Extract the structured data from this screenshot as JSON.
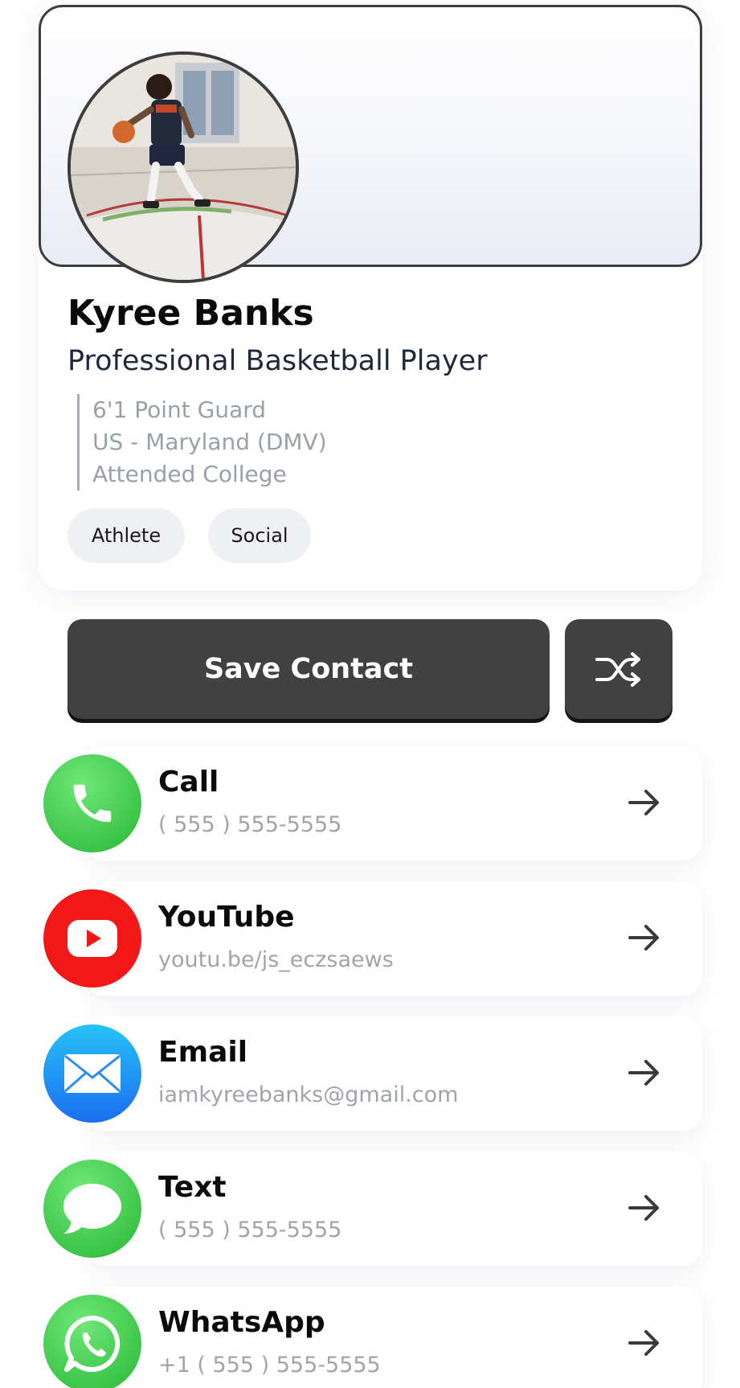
{
  "profile": {
    "name": "Kyree Banks",
    "title": "Professional Basketball Player",
    "bio": [
      "6'1 Point Guard",
      "US - Maryland (DMV)",
      "Attended College"
    ],
    "tags": [
      "Athlete",
      "Social"
    ]
  },
  "actions": {
    "save_label": "Save Contact",
    "shuffle_icon": "shuffle-icon"
  },
  "links": [
    {
      "title": "Call",
      "subtitle": "( 555 ) 555-5555",
      "icon": "phone-icon",
      "color": "#32c83f"
    },
    {
      "title": "YouTube",
      "subtitle": "youtu.be/js_eczsaews",
      "icon": "youtube-icon",
      "color": "#f21818"
    },
    {
      "title": "Email",
      "subtitle": "iamkyreebanks@gmail.com",
      "icon": "mail-icon",
      "color": "#2a8ef5"
    },
    {
      "title": "Text",
      "subtitle": "( 555 ) 555-5555",
      "icon": "message-icon",
      "color": "#32c83f"
    },
    {
      "title": "WhatsApp",
      "subtitle": "+1 ( 555 ) 555-5555",
      "icon": "whatsapp-icon",
      "color": "#32c83f"
    }
  ],
  "colors": {
    "button_dark": "#414141",
    "arrow": "#3a3a3a"
  }
}
